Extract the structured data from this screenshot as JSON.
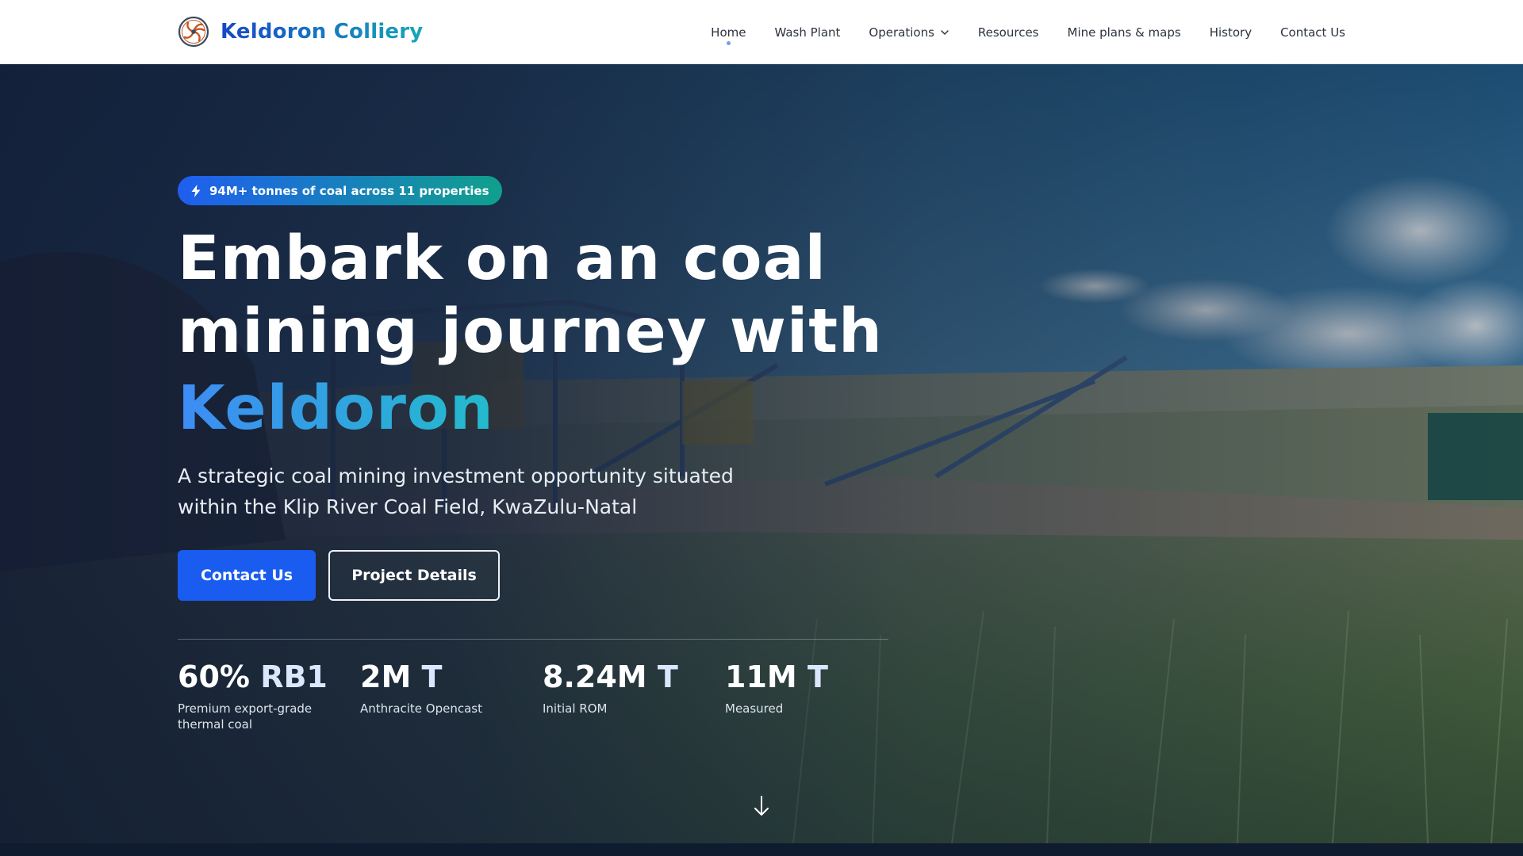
{
  "nav": {
    "brand": "Keldoron Colliery",
    "items": [
      {
        "label": "Home",
        "active": true
      },
      {
        "label": "Wash Plant"
      },
      {
        "label": "Operations",
        "has_dropdown": true
      },
      {
        "label": "Resources"
      },
      {
        "label": "Mine plans & maps"
      },
      {
        "label": "History"
      },
      {
        "label": "Contact Us"
      }
    ]
  },
  "hero": {
    "badge_icon": "lightning-bolt-icon",
    "badge": "94M+ tonnes of coal across 11 properties",
    "headline": "Embark on an coal mining journey with",
    "headline_accent": "Keldoron",
    "subtitle": "A strategic coal mining investment opportunity situated within the Klip River Coal Field, KwaZulu-Natal",
    "primary_button": "Contact Us",
    "secondary_button": "Project Details",
    "stats": [
      {
        "value": "60%",
        "unit": "RB1",
        "label": "Premium export-grade thermal coal"
      },
      {
        "value": "2M",
        "unit": "T",
        "label": "Anthracite Opencast"
      },
      {
        "value": "8.24M",
        "unit": "T",
        "label": "Initial ROM"
      },
      {
        "value": "11M",
        "unit": "T",
        "label": "Measured"
      }
    ],
    "scroll_icon": "arrow-down-icon"
  },
  "colors": {
    "brand_blue": "#1746c8",
    "brand_teal": "#16a7b8",
    "primary_button": "#1a5cf0",
    "active_dot": "#6f9df0"
  }
}
